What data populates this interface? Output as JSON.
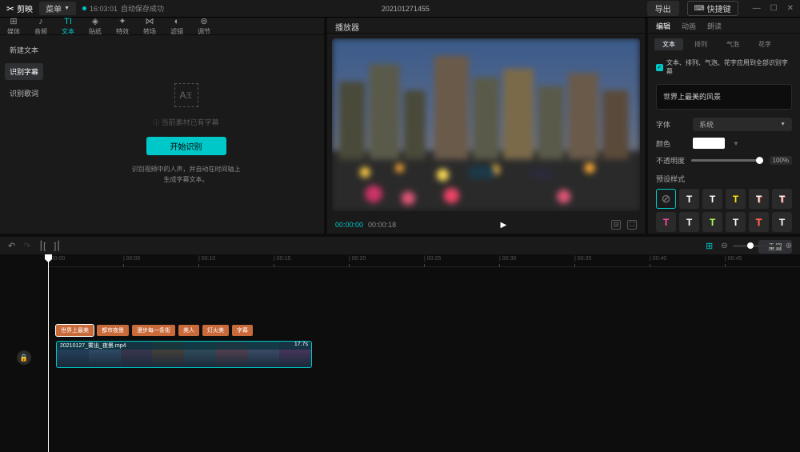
{
  "titlebar": {
    "logo": "剪映",
    "menu": "菜单",
    "status_time": "16:03:01",
    "status_text": "自动保存成功",
    "project_name": "202101271455",
    "export": "导出",
    "shortcut": "快捷键"
  },
  "left_tabs": [
    {
      "icon": "⊞",
      "label": "媒体"
    },
    {
      "icon": "♪",
      "label": "音频"
    },
    {
      "icon": "TI",
      "label": "文本"
    },
    {
      "icon": "◈",
      "label": "贴纸"
    },
    {
      "icon": "✦",
      "label": "特效"
    },
    {
      "icon": "⋈",
      "label": "转场"
    },
    {
      "icon": "◐",
      "label": "滤镜"
    },
    {
      "icon": "⊚",
      "label": "调节"
    }
  ],
  "left_side": [
    {
      "label": "新建文本"
    },
    {
      "label": "识别字幕"
    },
    {
      "label": "识别歌词"
    }
  ],
  "left_content": {
    "placeholder": "当前素材已有字幕",
    "action": "开始识别",
    "hint1": "识别视频中的人声，并自动在时间轴上",
    "hint2": "生成字幕文本。"
  },
  "player": {
    "title": "播放器",
    "time_current": "00:00:00",
    "time_duration": "00:00:18"
  },
  "right": {
    "tabs_top": [
      "编辑",
      "动画",
      "朗读"
    ],
    "tabs_sub": [
      "文本",
      "排列",
      "气泡",
      "花字"
    ],
    "checkbox": "文本、排列、气泡、花字应用到全部识别字幕",
    "text_value": "世界上最美的风景",
    "font_label": "字体",
    "font_value": "系统",
    "color_label": "颜色",
    "opacity_label": "不透明度",
    "opacity_value": "100%",
    "preset_label": "预设样式",
    "reset": "重置"
  },
  "ruler_ticks": [
    "00:00",
    "00:05",
    "00:10",
    "00:15",
    "00:20",
    "00:25",
    "00:30",
    "00:35",
    "00:40",
    "00:45"
  ],
  "text_clips": [
    "世界上最美",
    "都市夜景",
    "漫步每一条街",
    "美人",
    "灯火美",
    "字幕"
  ],
  "video_clip": {
    "name": "20210127_雾出_夜景.mp4",
    "duration": "17.7s"
  },
  "preset_colors": [
    "#fff",
    "#fff",
    "#ffea00",
    "#fff",
    "#fff",
    "#ff4da6",
    "#fff",
    "#aaff55",
    "#fff",
    "#ff6644",
    "#fff",
    "#ff3355"
  ]
}
